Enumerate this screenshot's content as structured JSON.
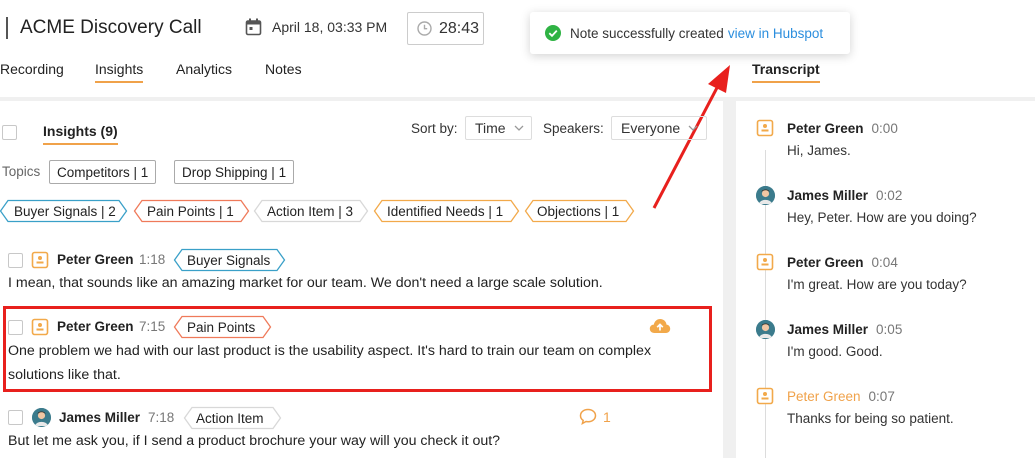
{
  "header": {
    "title": "ACME Discovery Call",
    "date": "April 18, 03:33 PM",
    "timer": "28:43"
  },
  "tabs": [
    {
      "label": "Recording",
      "active": false
    },
    {
      "label": "Insights",
      "active": true
    },
    {
      "label": "Analytics",
      "active": false
    },
    {
      "label": "Notes",
      "active": false
    }
  ],
  "toast": {
    "message": "Note successfully created",
    "link": "view in Hubspot"
  },
  "transcript_tab": "Transcript",
  "insights_panel": {
    "title": "Insights (9)",
    "sort_label": "Sort by:",
    "sort_value": "Time",
    "speakers_label": "Speakers:",
    "speakers_value": "Everyone",
    "topics_label": "Topics",
    "topics": [
      "Competitors | 1",
      "Drop Shipping | 1"
    ],
    "categories": [
      {
        "label": "Buyer Signals | 2",
        "color": "#3aa0c8"
      },
      {
        "label": "Pain Points | 1",
        "color": "#ef7a5a"
      },
      {
        "label": "Action Item | 3",
        "color": "#d8d8d8"
      },
      {
        "label": "Identified Needs | 1",
        "color": "#f2a94a"
      },
      {
        "label": "Objections | 1",
        "color": "#f2a94a"
      }
    ],
    "items": [
      {
        "speaker": "Peter Green",
        "time": "1:18",
        "tag": "Buyer Signals",
        "lines": [
          "I mean, that sounds like an amazing market for our team. We don't need a large scale solution."
        ]
      },
      {
        "speaker": "Peter Green",
        "time": "7:15",
        "tag": "Pain Points",
        "lines": [
          "One problem we had with our last product is the usability aspect. It's hard to train our team on complex",
          "solutions like that."
        ]
      },
      {
        "speaker": "James Miller",
        "time": "7:18",
        "tag": "Action Item",
        "comment_count": "1",
        "lines": [
          "But let me ask you, if I send a product brochure your way will you check it out?"
        ]
      }
    ]
  },
  "transcript": [
    {
      "speaker": "Peter Green",
      "time": "0:00",
      "text": "Hi, James.",
      "icon": "document-icon"
    },
    {
      "speaker": "James Miller",
      "time": "0:02",
      "text": "Hey, Peter. How are you doing?",
      "icon": "avatar"
    },
    {
      "speaker": "Peter Green",
      "time": "0:04",
      "text": "I'm great. How are you today?",
      "icon": "document-icon"
    },
    {
      "speaker": "James Miller",
      "time": "0:05",
      "text": "I'm good. Good.",
      "icon": "avatar"
    },
    {
      "speaker": "Peter Green",
      "time": "0:07",
      "text": "Thanks for being so patient.",
      "icon": "document-icon",
      "active": true
    }
  ],
  "colors": {
    "accent": "#f0a24a",
    "link": "#2b8ede",
    "success": "#2fb344",
    "annotation": "#e8201d"
  }
}
